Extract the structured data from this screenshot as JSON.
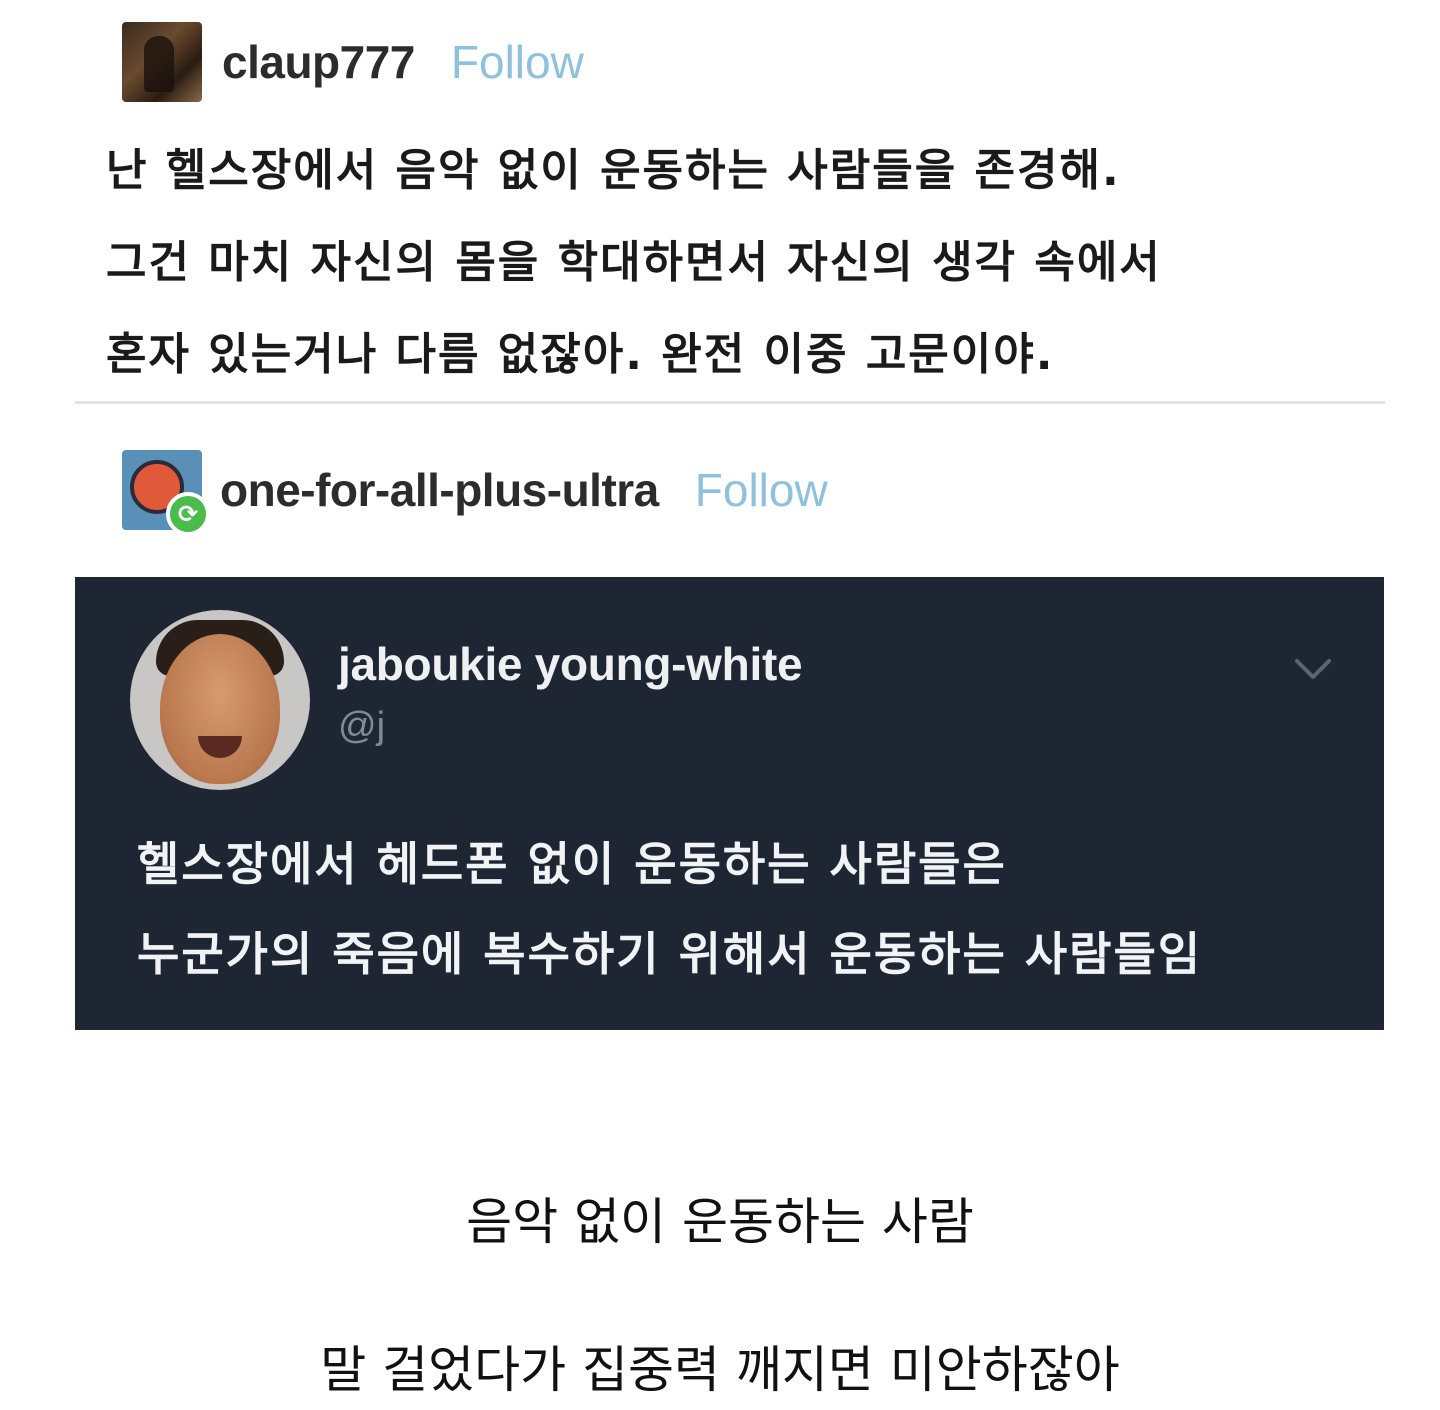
{
  "post1": {
    "username": "claup777",
    "follow_label": "Follow",
    "lines": [
      "난 헬스장에서 음악 없이 운동하는 사람들을 존경해.",
      "그건 마치 자신의 몸을 학대하면서 자신의 생각 속에서",
      "혼자 있는거나 다름 없잖아. 완전 이중 고문이야."
    ]
  },
  "post2": {
    "username": "one-for-all-plus-ultra",
    "follow_label": "Follow"
  },
  "tweet": {
    "name": "jaboukie young-white",
    "handle": "@j",
    "lines": [
      "헬스장에서 헤드폰 없이 운동하는 사람들은",
      "누군가의 죽음에 복수하기 위해서 운동하는 사람들임"
    ],
    "background_color": "#1e2634"
  },
  "caption": {
    "line1": "음악 없이 운동하는 사람",
    "line2": "말 걸었다가 집중력 깨지면 미안하잖아"
  },
  "colors": {
    "follow": "#8fc0dc",
    "reblog_badge": "#4bbb4b"
  },
  "icons": {
    "reblog": "reblog-icon",
    "chevron": "chevron-down-icon"
  }
}
